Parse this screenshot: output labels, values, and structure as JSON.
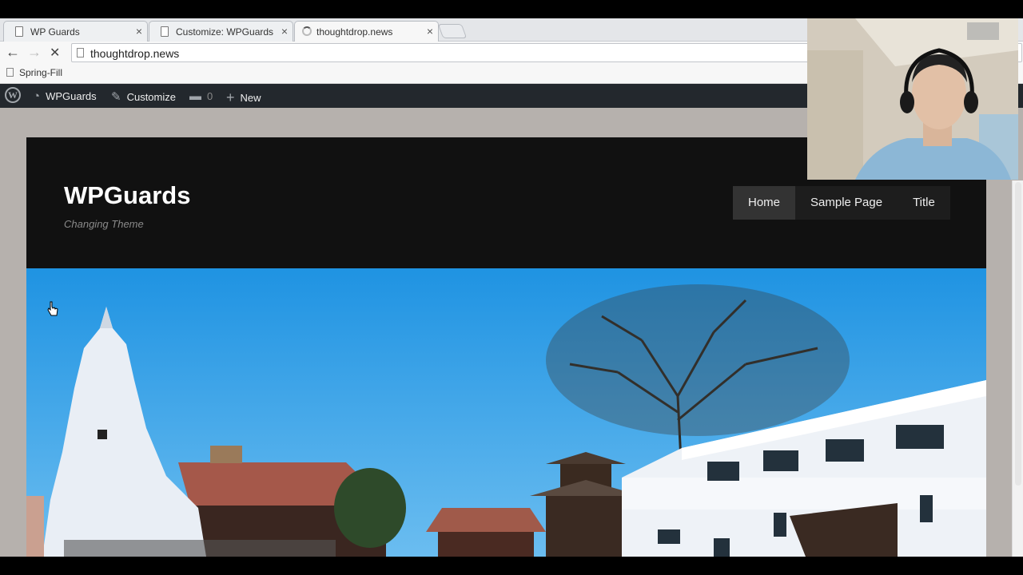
{
  "browser": {
    "tabs": [
      {
        "title": "WP Guards",
        "close": "×"
      },
      {
        "title": "Customize: WPGuards – ",
        "close": "×"
      },
      {
        "title": "thoughtdrop.news",
        "close": "×"
      }
    ],
    "nav": {
      "back": "←",
      "forward": "→",
      "stop": "✕"
    },
    "url": "thoughtdrop.news",
    "bookmarks": [
      "Spring-Fill"
    ]
  },
  "adminbar": {
    "site_name": "WPGuards",
    "customize": "Customize",
    "comments_count": "0",
    "new": "New"
  },
  "site": {
    "title": "WPGuards",
    "description": "Changing Theme",
    "menu": [
      "Home",
      "Sample Page",
      "Title"
    ]
  },
  "icons": {
    "wordpress": "wordpress-logo-icon",
    "dashboard": "dashboard-icon",
    "customize": "brush-icon",
    "comments": "comment-icon",
    "new": "plus-icon"
  },
  "colors": {
    "admin_bar": "#23282d",
    "site_header": "#111111",
    "sky": "#2f9be0"
  }
}
